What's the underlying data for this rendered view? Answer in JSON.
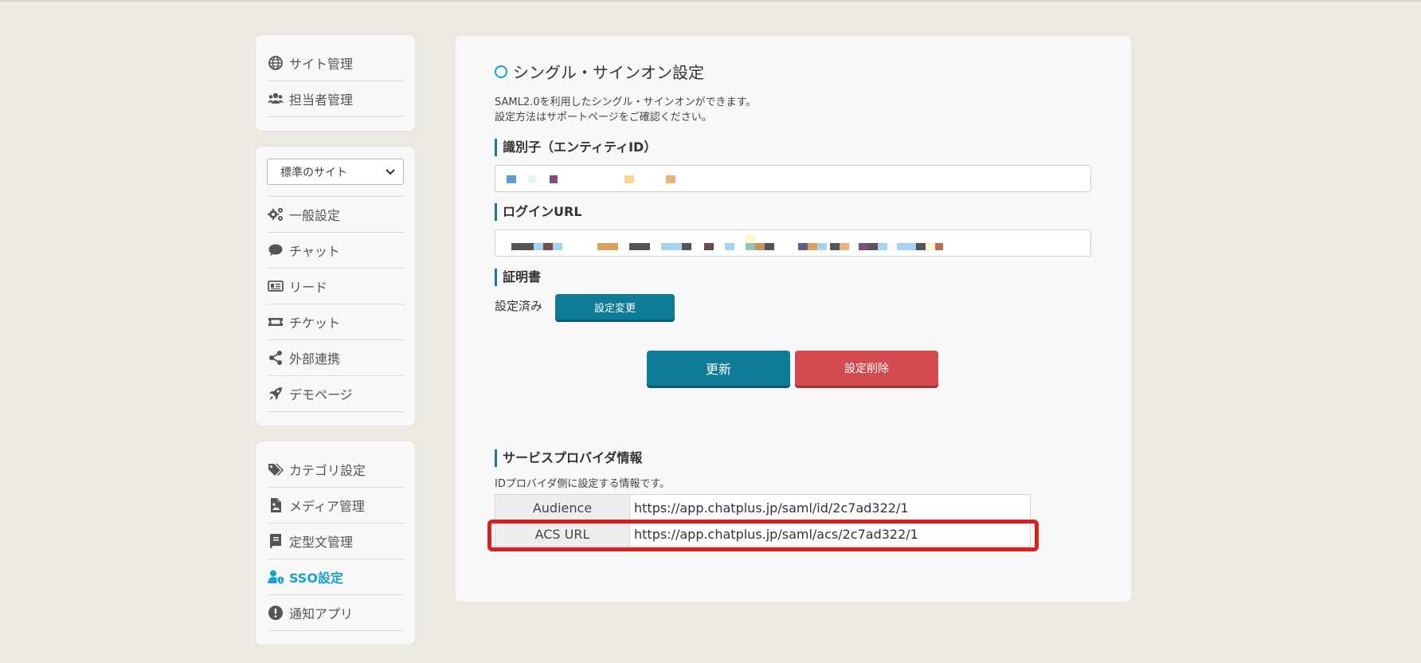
{
  "sidebar": {
    "top_items": [
      {
        "label": "サイト管理",
        "icon": "globe-icon"
      },
      {
        "label": "担当者管理",
        "icon": "users-icon"
      }
    ],
    "site_select": {
      "value": "標準のサイト"
    },
    "settings_items": [
      {
        "label": "一般設定",
        "icon": "gears-icon"
      },
      {
        "label": "チャット",
        "icon": "chat-bubble-icon"
      },
      {
        "label": "リード",
        "icon": "id-card-icon"
      },
      {
        "label": "チケット",
        "icon": "ticket-icon"
      },
      {
        "label": "外部連携",
        "icon": "share-icon"
      },
      {
        "label": "デモページ",
        "icon": "rocket-icon"
      }
    ],
    "other_items": [
      {
        "label": "カテゴリ設定",
        "icon": "tags-icon"
      },
      {
        "label": "メディア管理",
        "icon": "file-image-icon"
      },
      {
        "label": "定型文管理",
        "icon": "book-icon"
      },
      {
        "label": "SSO設定",
        "icon": "user-shield-icon",
        "active": true
      },
      {
        "label": "通知アプリ",
        "icon": "exclamation-circle-icon"
      }
    ],
    "active_color": "#1aa3c9"
  },
  "main": {
    "title": "シングル・サインオン設定",
    "desc_line1": "SAML2.0を利用したシングル・サインオンができます。",
    "desc_line2": "設定方法はサポートページをご確認ください。",
    "entity_label": "識別子（エンティティID）",
    "login_url_label": "ログインURL",
    "cert_label": "証明書",
    "cert_status": "設定済み",
    "change_button": "設定変更",
    "update_button": "更新",
    "delete_button": "設定削除",
    "sp_label": "サービスプロバイダ情報",
    "sp_desc": "IDプロバイダ側に設定する情報です。",
    "sp_rows": [
      {
        "key": "Audience",
        "value": "https://app.chatplus.jp/saml/id/2c7ad322/1"
      },
      {
        "key": "ACS URL",
        "value": "https://app.chatplus.jp/saml/acs/2c7ad322/1"
      }
    ]
  },
  "colors": {
    "primary": "#0e7b97",
    "danger": "#d34a4f",
    "highlight": "#d91e1e"
  }
}
